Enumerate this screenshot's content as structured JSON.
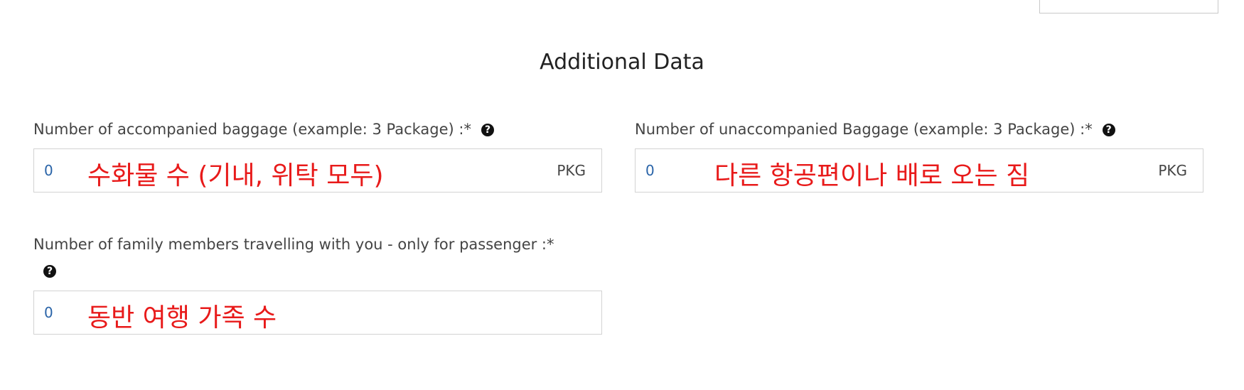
{
  "section_title": "Additional Data",
  "fields": {
    "accompanied": {
      "label": "Number of accompanied baggage (example: 3 Package) :*",
      "value": "0",
      "unit": "PKG",
      "annotation": "수화물 수 (기내, 위탁 모두)"
    },
    "unaccompanied": {
      "label": "Number of unaccompanied Baggage (example: 3 Package) :*",
      "value": "0",
      "unit": "PKG",
      "annotation": "다른 항공편이나 배로 오는 짐"
    },
    "family": {
      "label": "Number of family members travelling with you - only for passenger :*",
      "value": "0",
      "annotation": "동반 여행 가족 수"
    }
  },
  "help_icon": "question-circle-icon",
  "colors": {
    "annotation": "#e81a1a",
    "value_text": "#2a64a8",
    "border": "#d3d3d3"
  }
}
